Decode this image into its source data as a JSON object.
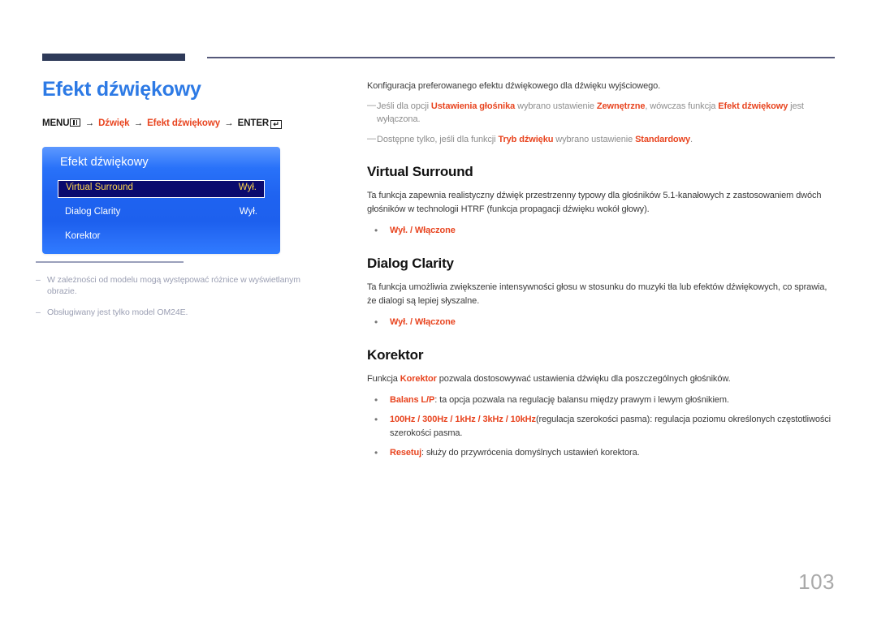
{
  "page": {
    "title": "Efekt dźwiękowy",
    "number": "103",
    "accent_blue": "#2d7ae5",
    "accent_red": "#e8441f",
    "rule_navy": "#2e3a59"
  },
  "breadcrumb": {
    "menu_label": "MENU",
    "menu_icon": "menu-grid-icon",
    "arrow": "→",
    "items": [
      {
        "label": "Dźwięk",
        "accent": true
      },
      {
        "label": "Efekt dźwiękowy",
        "accent": true
      }
    ],
    "enter_label": "ENTER",
    "enter_icon": "enter-key-icon",
    "enter_glyph": "↵"
  },
  "osd": {
    "name": "osd-menu-preview",
    "title": "Efekt dźwiękowy",
    "rows": [
      {
        "label": "Virtual Surround",
        "value": "Wył.",
        "selected": true
      },
      {
        "label": "Dialog Clarity",
        "value": "Wył.",
        "selected": false
      },
      {
        "label": "Korektor",
        "value": "",
        "selected": false
      }
    ]
  },
  "left_notes": [
    {
      "dash": "‒",
      "text": "W zależności od modelu mogą występować różnice w wyświetlanym obrazie."
    },
    {
      "dash": "‒",
      "text": "Obsługiwany jest tylko model OM24E."
    }
  ],
  "right": {
    "intro": "Konfiguracja preferowanego efektu dźwiękowego dla dźwięku wyjściowego.",
    "tips": [
      {
        "dash": "—",
        "parts": [
          {
            "t": "Jeśli dla opcji ",
            "hl": false
          },
          {
            "t": "Ustawienia głośnika",
            "hl": true
          },
          {
            "t": " wybrano ustawienie ",
            "hl": false
          },
          {
            "t": "Zewnętrzne",
            "hl": true
          },
          {
            "t": ", wówczas funkcja ",
            "hl": false
          },
          {
            "t": "Efekt dźwiękowy",
            "hl": true
          },
          {
            "t": " jest wyłączona.",
            "hl": false
          }
        ]
      },
      {
        "dash": "—",
        "parts": [
          {
            "t": "Dostępne tylko, jeśli dla funkcji ",
            "hl": false
          },
          {
            "t": "Tryb dźwięku",
            "hl": true
          },
          {
            "t": " wybrano ustawienie ",
            "hl": false
          },
          {
            "t": "Standardowy",
            "hl": true
          },
          {
            "t": ".",
            "hl": false
          }
        ]
      }
    ],
    "sections": [
      {
        "id": "virtual-surround",
        "heading": "Virtual Surround",
        "paragraph": "Ta funkcja zapewnia realistyczny dźwięk przestrzenny typowy dla głośników 5.1-kanałowych z zastosowaniem dwóch głośników w technologii HTRF (funkcja propagacji dźwięku wokół głowy).",
        "bullets": [
          {
            "dot": "•",
            "parts": [
              {
                "t": "Wył. / Włączone",
                "hl": true
              }
            ]
          }
        ]
      },
      {
        "id": "dialog-clarity",
        "heading": "Dialog Clarity",
        "paragraph": "Ta funkcja umożliwia zwiększenie intensywności głosu w stosunku do muzyki tła lub efektów dźwiękowych, co sprawia, że dialogi są lepiej słyszalne.",
        "bullets": [
          {
            "dot": "•",
            "parts": [
              {
                "t": "Wył. / Włączone",
                "hl": true
              }
            ]
          }
        ]
      },
      {
        "id": "korektor",
        "heading": "Korektor",
        "paragraph_parts": [
          {
            "t": "Funkcja ",
            "hl": false
          },
          {
            "t": "Korektor",
            "hl": true
          },
          {
            "t": " pozwala dostosowywać ustawienia dźwięku dla poszczególnych głośników.",
            "hl": false
          }
        ],
        "bullets": [
          {
            "dot": "•",
            "parts": [
              {
                "t": "Balans L/P",
                "hl": true
              },
              {
                "t": ": ta opcja pozwala na regulację balansu między prawym i lewym głośnikiem.",
                "hl": false
              }
            ]
          },
          {
            "dot": "•",
            "parts": [
              {
                "t": "100Hz / 300Hz / 1kHz / 3kHz / 10kHz",
                "hl": true
              },
              {
                "t": "(regulacja szerokości pasma): regulacja poziomu określonych częstotliwości szerokości pasma.",
                "hl": false
              }
            ]
          },
          {
            "dot": "•",
            "parts": [
              {
                "t": "Resetuj",
                "hl": true
              },
              {
                "t": ": służy do przywrócenia domyślnych ustawień korektora.",
                "hl": false
              }
            ]
          }
        ]
      }
    ]
  }
}
